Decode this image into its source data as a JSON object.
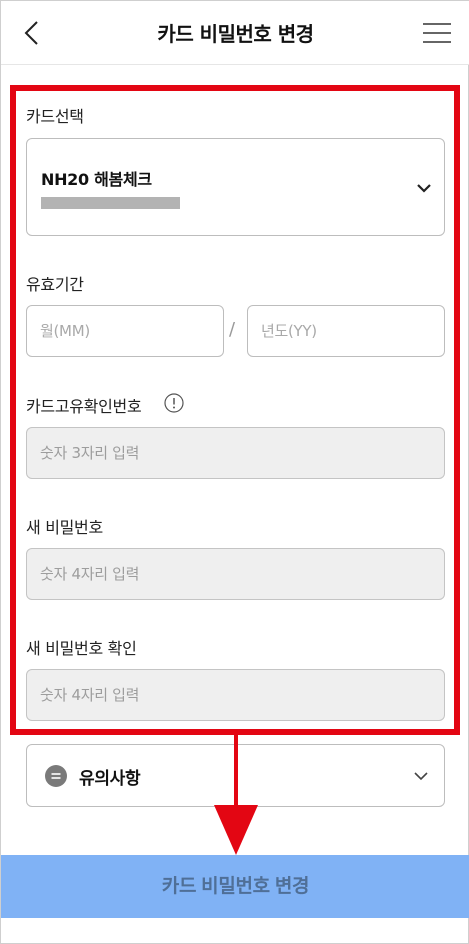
{
  "header": {
    "title": "카드 비밀번호 변경",
    "back_icon": "chevron-left-icon",
    "menu_icon": "hamburger-menu-icon"
  },
  "form": {
    "card_select": {
      "label": "카드선택",
      "selected_card": "NH20 해봄체크",
      "icon": "chevron-down-icon"
    },
    "expiry": {
      "label": "유효기간",
      "month_placeholder": "월(MM)",
      "separator": "/",
      "year_placeholder": "년도(YY)"
    },
    "cvc": {
      "label": "카드고유확인번호",
      "info_icon": "info-circle-icon",
      "placeholder": "숫자 3자리 입력"
    },
    "new_password": {
      "label": "새 비밀번호",
      "placeholder": "숫자 4자리 입력"
    },
    "confirm_password": {
      "label": "새 비밀번호 확인",
      "placeholder": "숫자 4자리 입력"
    }
  },
  "notice": {
    "label": "유의사항",
    "icon": "notice-circle-icon",
    "chevron": "chevron-down-icon"
  },
  "submit": {
    "label": "카드 비밀번호 변경"
  },
  "colors": {
    "highlight": "#e30613",
    "submit_bg": "#80b2f5",
    "disabled_bg": "#efefef"
  }
}
